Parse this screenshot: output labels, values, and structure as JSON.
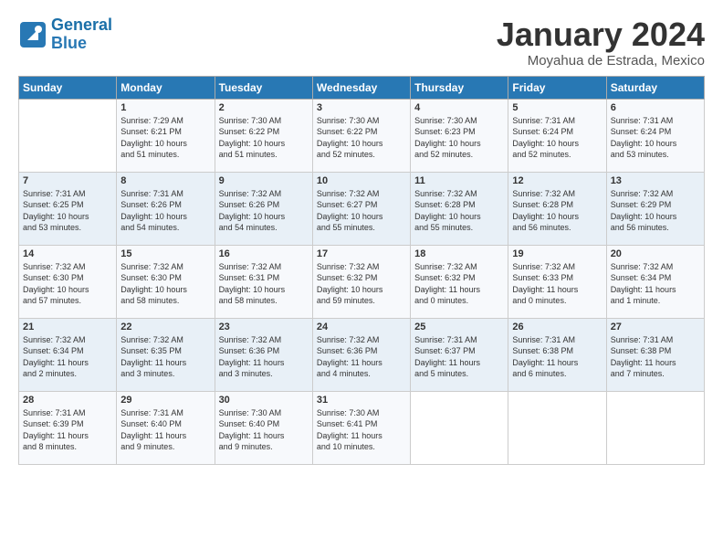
{
  "logo": {
    "line1": "General",
    "line2": "Blue"
  },
  "title": "January 2024",
  "subtitle": "Moyahua de Estrada, Mexico",
  "days_of_week": [
    "Sunday",
    "Monday",
    "Tuesday",
    "Wednesday",
    "Thursday",
    "Friday",
    "Saturday"
  ],
  "weeks": [
    [
      {
        "day": "",
        "info": ""
      },
      {
        "day": "1",
        "info": "Sunrise: 7:29 AM\nSunset: 6:21 PM\nDaylight: 10 hours\nand 51 minutes."
      },
      {
        "day": "2",
        "info": "Sunrise: 7:30 AM\nSunset: 6:22 PM\nDaylight: 10 hours\nand 51 minutes."
      },
      {
        "day": "3",
        "info": "Sunrise: 7:30 AM\nSunset: 6:22 PM\nDaylight: 10 hours\nand 52 minutes."
      },
      {
        "day": "4",
        "info": "Sunrise: 7:30 AM\nSunset: 6:23 PM\nDaylight: 10 hours\nand 52 minutes."
      },
      {
        "day": "5",
        "info": "Sunrise: 7:31 AM\nSunset: 6:24 PM\nDaylight: 10 hours\nand 52 minutes."
      },
      {
        "day": "6",
        "info": "Sunrise: 7:31 AM\nSunset: 6:24 PM\nDaylight: 10 hours\nand 53 minutes."
      }
    ],
    [
      {
        "day": "7",
        "info": "Sunrise: 7:31 AM\nSunset: 6:25 PM\nDaylight: 10 hours\nand 53 minutes."
      },
      {
        "day": "8",
        "info": "Sunrise: 7:31 AM\nSunset: 6:26 PM\nDaylight: 10 hours\nand 54 minutes."
      },
      {
        "day": "9",
        "info": "Sunrise: 7:32 AM\nSunset: 6:26 PM\nDaylight: 10 hours\nand 54 minutes."
      },
      {
        "day": "10",
        "info": "Sunrise: 7:32 AM\nSunset: 6:27 PM\nDaylight: 10 hours\nand 55 minutes."
      },
      {
        "day": "11",
        "info": "Sunrise: 7:32 AM\nSunset: 6:28 PM\nDaylight: 10 hours\nand 55 minutes."
      },
      {
        "day": "12",
        "info": "Sunrise: 7:32 AM\nSunset: 6:28 PM\nDaylight: 10 hours\nand 56 minutes."
      },
      {
        "day": "13",
        "info": "Sunrise: 7:32 AM\nSunset: 6:29 PM\nDaylight: 10 hours\nand 56 minutes."
      }
    ],
    [
      {
        "day": "14",
        "info": "Sunrise: 7:32 AM\nSunset: 6:30 PM\nDaylight: 10 hours\nand 57 minutes."
      },
      {
        "day": "15",
        "info": "Sunrise: 7:32 AM\nSunset: 6:30 PM\nDaylight: 10 hours\nand 58 minutes."
      },
      {
        "day": "16",
        "info": "Sunrise: 7:32 AM\nSunset: 6:31 PM\nDaylight: 10 hours\nand 58 minutes."
      },
      {
        "day": "17",
        "info": "Sunrise: 7:32 AM\nSunset: 6:32 PM\nDaylight: 10 hours\nand 59 minutes."
      },
      {
        "day": "18",
        "info": "Sunrise: 7:32 AM\nSunset: 6:32 PM\nDaylight: 11 hours\nand 0 minutes."
      },
      {
        "day": "19",
        "info": "Sunrise: 7:32 AM\nSunset: 6:33 PM\nDaylight: 11 hours\nand 0 minutes."
      },
      {
        "day": "20",
        "info": "Sunrise: 7:32 AM\nSunset: 6:34 PM\nDaylight: 11 hours\nand 1 minute."
      }
    ],
    [
      {
        "day": "21",
        "info": "Sunrise: 7:32 AM\nSunset: 6:34 PM\nDaylight: 11 hours\nand 2 minutes."
      },
      {
        "day": "22",
        "info": "Sunrise: 7:32 AM\nSunset: 6:35 PM\nDaylight: 11 hours\nand 3 minutes."
      },
      {
        "day": "23",
        "info": "Sunrise: 7:32 AM\nSunset: 6:36 PM\nDaylight: 11 hours\nand 3 minutes."
      },
      {
        "day": "24",
        "info": "Sunrise: 7:32 AM\nSunset: 6:36 PM\nDaylight: 11 hours\nand 4 minutes."
      },
      {
        "day": "25",
        "info": "Sunrise: 7:31 AM\nSunset: 6:37 PM\nDaylight: 11 hours\nand 5 minutes."
      },
      {
        "day": "26",
        "info": "Sunrise: 7:31 AM\nSunset: 6:38 PM\nDaylight: 11 hours\nand 6 minutes."
      },
      {
        "day": "27",
        "info": "Sunrise: 7:31 AM\nSunset: 6:38 PM\nDaylight: 11 hours\nand 7 minutes."
      }
    ],
    [
      {
        "day": "28",
        "info": "Sunrise: 7:31 AM\nSunset: 6:39 PM\nDaylight: 11 hours\nand 8 minutes."
      },
      {
        "day": "29",
        "info": "Sunrise: 7:31 AM\nSunset: 6:40 PM\nDaylight: 11 hours\nand 9 minutes."
      },
      {
        "day": "30",
        "info": "Sunrise: 7:30 AM\nSunset: 6:40 PM\nDaylight: 11 hours\nand 9 minutes."
      },
      {
        "day": "31",
        "info": "Sunrise: 7:30 AM\nSunset: 6:41 PM\nDaylight: 11 hours\nand 10 minutes."
      },
      {
        "day": "",
        "info": ""
      },
      {
        "day": "",
        "info": ""
      },
      {
        "day": "",
        "info": ""
      }
    ]
  ]
}
